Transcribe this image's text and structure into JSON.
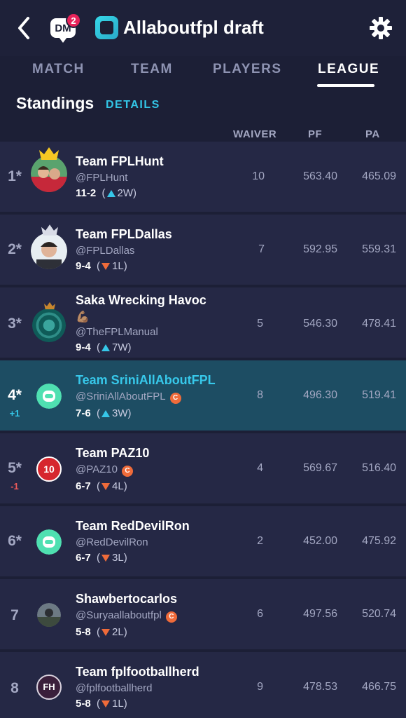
{
  "header": {
    "title": "Allaboutfpl draft",
    "dm_label": "DM",
    "dm_count": "2"
  },
  "tabs": [
    {
      "label": "MATCH"
    },
    {
      "label": "TEAM"
    },
    {
      "label": "PLAYERS"
    },
    {
      "label": "LEAGUE"
    }
  ],
  "standings": {
    "title": "Standings",
    "details_label": "DETAILS",
    "columns": {
      "waiver": "WAIVER",
      "pf": "PF",
      "pa": "PA"
    }
  },
  "rows": [
    {
      "rank": "1*",
      "rank_change": "",
      "team": "Team FPLHunt",
      "handle": "@FPLHunt",
      "record": "11-2",
      "streak": "2W",
      "streak_dir": "up",
      "waiver": "10",
      "pf": "563.40",
      "pa": "465.09",
      "badge": ""
    },
    {
      "rank": "2*",
      "rank_change": "",
      "team": "Team FPLDallas",
      "handle": "@FPLDallas",
      "record": "9-4",
      "streak": "1L",
      "streak_dir": "down",
      "waiver": "7",
      "pf": "592.95",
      "pa": "559.31",
      "badge": ""
    },
    {
      "rank": "3*",
      "rank_change": "",
      "team": "Saka Wrecking Havoc",
      "team_emoji": "💪🏽",
      "handle": "@TheFPLManual",
      "record": "9-4",
      "streak": "7W",
      "streak_dir": "up",
      "waiver": "5",
      "pf": "546.30",
      "pa": "478.41",
      "badge": ""
    },
    {
      "rank": "4*",
      "rank_change": "+1",
      "team": "Team SriniAllAboutFPL",
      "handle": "@SriniAllAboutFPL",
      "record": "7-6",
      "streak": "3W",
      "streak_dir": "up",
      "waiver": "8",
      "pf": "496.30",
      "pa": "519.41",
      "badge": "C"
    },
    {
      "rank": "5*",
      "rank_change": "-1",
      "team": "Team PAZ10",
      "handle": "@PAZ10",
      "record": "6-7",
      "streak": "4L",
      "streak_dir": "down",
      "waiver": "4",
      "pf": "569.67",
      "pa": "516.40",
      "badge": "C"
    },
    {
      "rank": "6*",
      "rank_change": "",
      "team": "Team RedDevilRon",
      "handle": "@RedDevilRon",
      "record": "6-7",
      "streak": "3L",
      "streak_dir": "down",
      "waiver": "2",
      "pf": "452.00",
      "pa": "475.92",
      "badge": ""
    },
    {
      "rank": "7",
      "rank_change": "",
      "team": "Shawbertocarlos",
      "handle": "@Suryaallaboutfpl",
      "record": "5-8",
      "streak": "2L",
      "streak_dir": "down",
      "waiver": "6",
      "pf": "497.56",
      "pa": "520.74",
      "badge": "C"
    },
    {
      "rank": "8",
      "rank_change": "",
      "team": "Team fplfootballherd",
      "handle": "@fplfootballherd",
      "record": "5-8",
      "streak": "1L",
      "streak_dir": "down",
      "waiver": "9",
      "pf": "478.53",
      "pa": "466.75",
      "badge": ""
    }
  ],
  "avatars": {
    "row5_text": "10",
    "row8_text": "FH"
  },
  "colors": {
    "background": "#1c1f36",
    "row": "#252845",
    "highlight_row": "#1d4d63",
    "accent": "#33c5e6",
    "down": "#ef6b3a",
    "badge_dm": "#e8235a"
  }
}
